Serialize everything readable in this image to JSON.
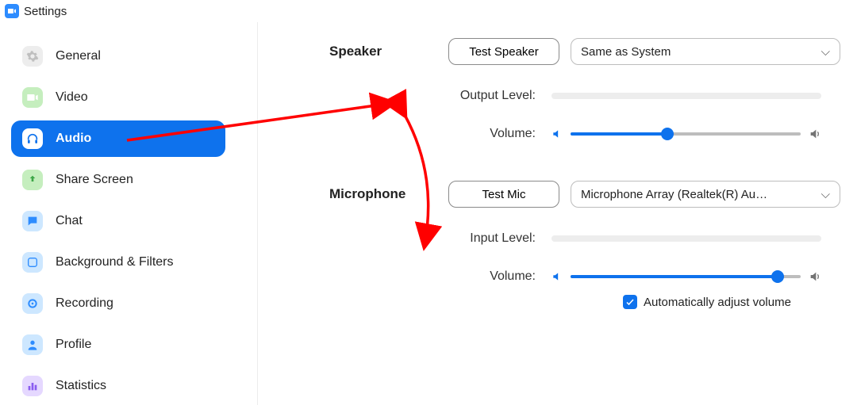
{
  "window": {
    "title": "Settings"
  },
  "sidebar": {
    "items": [
      {
        "label": "General"
      },
      {
        "label": "Video"
      },
      {
        "label": "Audio"
      },
      {
        "label": "Share Screen"
      },
      {
        "label": "Chat"
      },
      {
        "label": "Background & Filters"
      },
      {
        "label": "Recording"
      },
      {
        "label": "Profile"
      },
      {
        "label": "Statistics"
      }
    ]
  },
  "speaker": {
    "heading": "Speaker",
    "test_label": "Test Speaker",
    "device": "Same as System",
    "output_level_label": "Output Level:",
    "volume_label": "Volume:",
    "volume_percent": 42
  },
  "microphone": {
    "heading": "Microphone",
    "test_label": "Test Mic",
    "device": "Microphone Array (Realtek(R) Au…",
    "input_level_label": "Input Level:",
    "volume_label": "Volume:",
    "volume_percent": 90,
    "auto_adjust_label": "Automatically adjust volume",
    "auto_adjust_checked": true
  }
}
